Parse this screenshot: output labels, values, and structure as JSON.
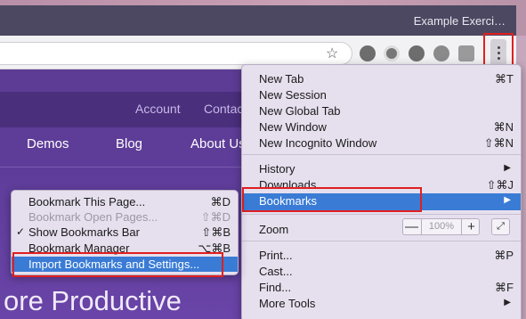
{
  "window": {
    "title": "Example Exerci…"
  },
  "site": {
    "top_nav": [
      "Account",
      "Contac"
    ],
    "main_nav": [
      "Demos",
      "Blog",
      "About Us"
    ],
    "hero": "ore Productive"
  },
  "icons": [
    "star-icon",
    "check-circle-icon",
    "crosshair-icon",
    "refresh-icon",
    "avatar-icon",
    "bookmark-ext-icon",
    "kebab-menu-icon"
  ],
  "chrome_menu": {
    "items": [
      {
        "label": "New Tab",
        "shortcut": "⌘T"
      },
      {
        "label": "New Session",
        "shortcut": ""
      },
      {
        "label": "New Global Tab",
        "shortcut": ""
      },
      {
        "label": "New Window",
        "shortcut": "⌘N"
      },
      {
        "label": "New Incognito Window",
        "shortcut": "⇧⌘N"
      },
      {
        "label": "History",
        "shortcut": "▶"
      },
      {
        "label": "Downloads",
        "shortcut": "⇧⌘J"
      },
      {
        "label": "Bookmarks",
        "shortcut": "▶"
      },
      {
        "label": "Zoom",
        "shortcut": ""
      },
      {
        "label": "Print...",
        "shortcut": "⌘P"
      },
      {
        "label": "Cast...",
        "shortcut": ""
      },
      {
        "label": "Find...",
        "shortcut": "⌘F"
      },
      {
        "label": "More Tools",
        "shortcut": "▶"
      }
    ],
    "zoom": {
      "minus": "—",
      "value": "100%",
      "plus": "+",
      "fullscreen": "⤢"
    }
  },
  "bookmarks_submenu": {
    "items": [
      {
        "label": "Bookmark This Page...",
        "shortcut": "⌘D"
      },
      {
        "label": "Bookmark Open Pages...",
        "shortcut": "⇧⌘D"
      },
      {
        "label": "Show Bookmarks Bar",
        "shortcut": "⇧⌘B",
        "check": "✓"
      },
      {
        "label": "Bookmark Manager",
        "shortcut": "⌥⌘B"
      },
      {
        "label": "Import Bookmarks and Settings...",
        "shortcut": ""
      }
    ]
  }
}
